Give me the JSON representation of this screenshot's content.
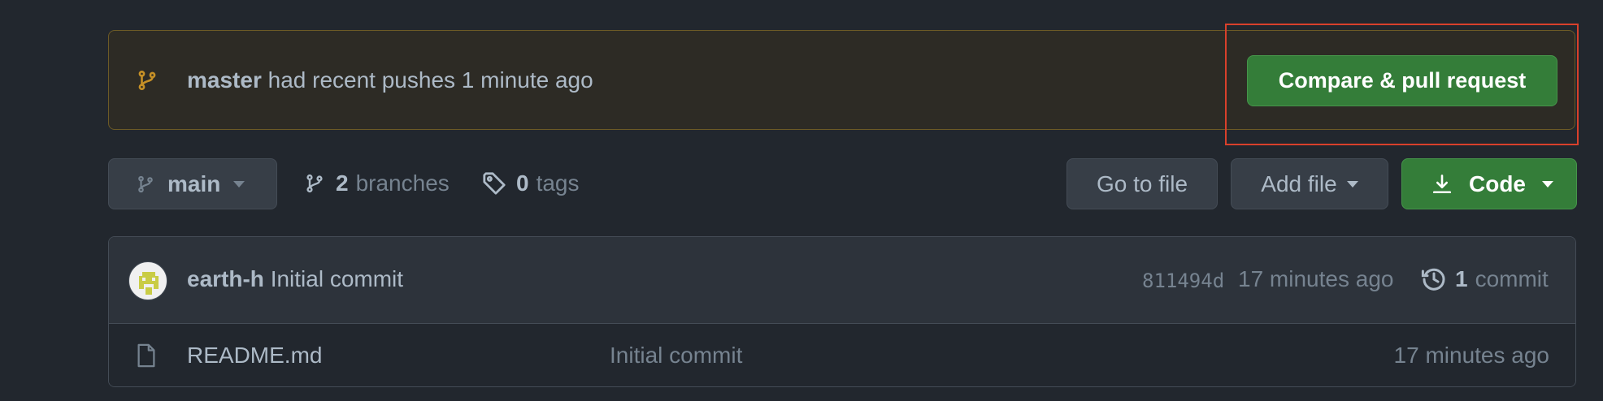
{
  "banner": {
    "branch": "master",
    "message": "had recent pushes 1 minute ago",
    "compare_button": "Compare & pull request",
    "icon": "git-branch-icon"
  },
  "toolbar": {
    "branch_select": "main",
    "branches_count": "2",
    "branches_label": "branches",
    "tags_count": "0",
    "tags_label": "tags",
    "go_to_file": "Go to file",
    "add_file": "Add file",
    "code": "Code"
  },
  "commit": {
    "author": "earth-h",
    "message": "Initial commit",
    "sha": "811494d",
    "time": "17 minutes ago",
    "count": "1",
    "count_label": "commit"
  },
  "files": [
    {
      "name": "README.md",
      "message": "Initial commit",
      "time": "17 minutes ago",
      "icon": "file-icon"
    }
  ],
  "colors": {
    "background": "#22272e",
    "banner_border": "#6c5a26",
    "banner_icon": "#c69026",
    "green_button": "#347d39",
    "annotation_box": "#d9402b"
  }
}
